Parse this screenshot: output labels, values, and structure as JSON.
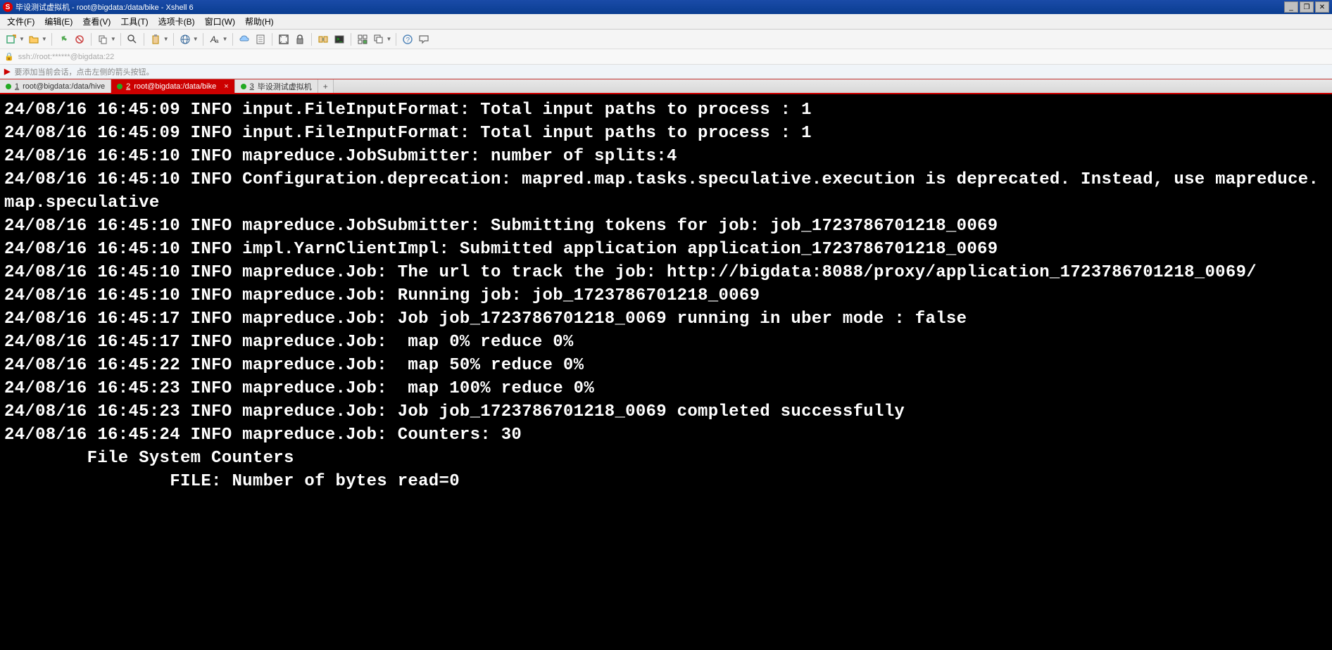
{
  "window": {
    "title": "毕设测试虚拟机 - root@bigdata:/data/bike - Xshell 6"
  },
  "menu": {
    "file": "文件(F)",
    "edit": "编辑(E)",
    "view": "查看(V)",
    "tools": "工具(T)",
    "tab": "选项卡(B)",
    "window": "窗口(W)",
    "help": "帮助(H)"
  },
  "address": {
    "text": "ssh://root:******@bigdata:22"
  },
  "hint": {
    "text": "要添加当前会话，点击左侧的箭头按钮。"
  },
  "tabs": [
    {
      "num": "1",
      "label": "root@bigdata:/data/hive",
      "active": false
    },
    {
      "num": "2",
      "label": "root@bigdata:/data/bike",
      "active": true
    },
    {
      "num": "3",
      "label": "毕设测试虚拟机",
      "active": false
    }
  ],
  "terminal_lines": [
    "24/08/16 16:45:09 INFO input.FileInputFormat: Total input paths to process : 1",
    "24/08/16 16:45:09 INFO input.FileInputFormat: Total input paths to process : 1",
    "24/08/16 16:45:10 INFO mapreduce.JobSubmitter: number of splits:4",
    "24/08/16 16:45:10 INFO Configuration.deprecation: mapred.map.tasks.speculative.execution is deprecated. Instead, use mapreduce.map.speculative",
    "24/08/16 16:45:10 INFO mapreduce.JobSubmitter: Submitting tokens for job: job_1723786701218_0069",
    "24/08/16 16:45:10 INFO impl.YarnClientImpl: Submitted application application_1723786701218_0069",
    "24/08/16 16:45:10 INFO mapreduce.Job: The url to track the job: http://bigdata:8088/proxy/application_1723786701218_0069/",
    "24/08/16 16:45:10 INFO mapreduce.Job: Running job: job_1723786701218_0069",
    "24/08/16 16:45:17 INFO mapreduce.Job: Job job_1723786701218_0069 running in uber mode : false",
    "24/08/16 16:45:17 INFO mapreduce.Job:  map 0% reduce 0%",
    "24/08/16 16:45:22 INFO mapreduce.Job:  map 50% reduce 0%",
    "24/08/16 16:45:23 INFO mapreduce.Job:  map 100% reduce 0%",
    "24/08/16 16:45:23 INFO mapreduce.Job: Job job_1723786701218_0069 completed successfully",
    "24/08/16 16:45:24 INFO mapreduce.Job: Counters: 30",
    "        File System Counters",
    "                FILE: Number of bytes read=0"
  ]
}
